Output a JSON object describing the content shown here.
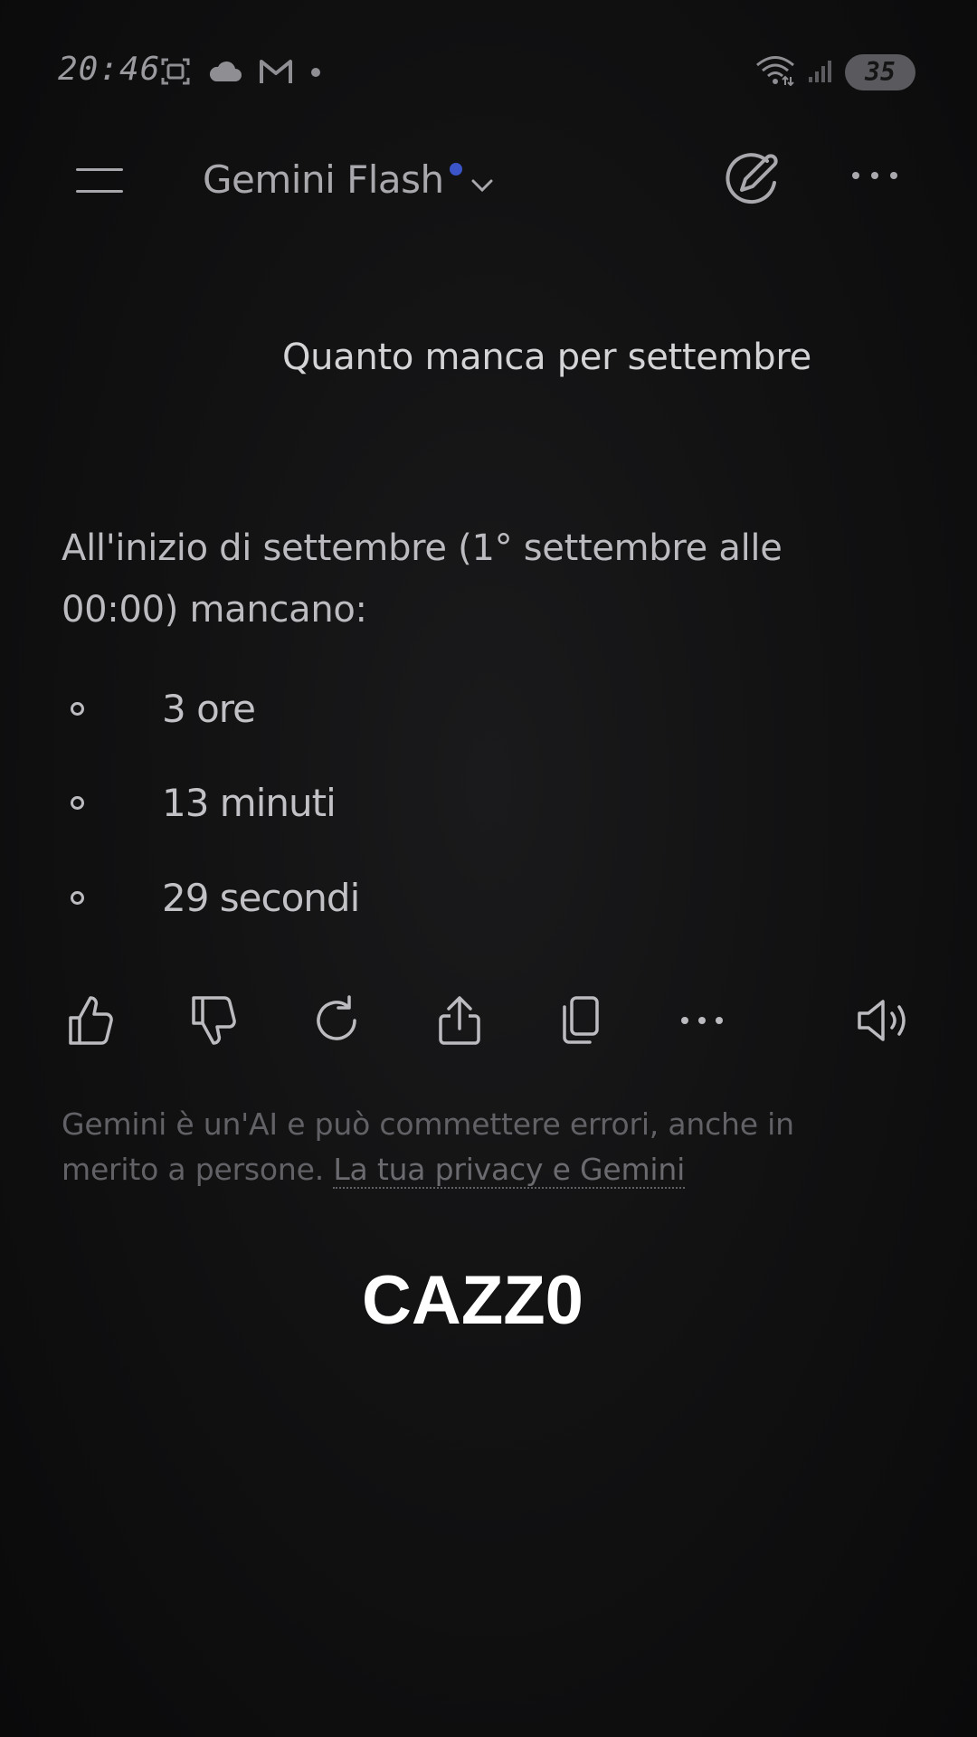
{
  "status_bar": {
    "time": "20:46",
    "battery": "35",
    "icons_left": [
      "screenshot-icon",
      "cloud-icon",
      "gmail-icon",
      "dot-icon"
    ],
    "icons_right": [
      "wifi-icon",
      "signal-icon",
      "battery-icon"
    ]
  },
  "header": {
    "model_name": "Gemini Flash",
    "menu_icon": "menu-icon",
    "edit_icon": "edit-icon",
    "more_icon": "more-icon",
    "accent": "#3b54c8"
  },
  "conversation": {
    "user_message": "Quanto manca per settembre",
    "response_line1": "All'inizio di settembre (1° settembre alle",
    "response_line2": "00:00) mancano:",
    "bullets": [
      "3 ore",
      "13 minuti",
      "29 secondi"
    ]
  },
  "actions": {
    "items": [
      "thumbs-up-icon",
      "thumbs-down-icon",
      "regenerate-icon",
      "share-icon",
      "copy-icon",
      "more-icon",
      "speaker-icon"
    ]
  },
  "disclaimer": {
    "line1": "Gemini è un'AI e può commettere errori, anche in",
    "line2_prefix": "merito a persone. ",
    "privacy_link": "La tua privacy e Gemini"
  },
  "caption": {
    "text": "CAZZ0"
  }
}
